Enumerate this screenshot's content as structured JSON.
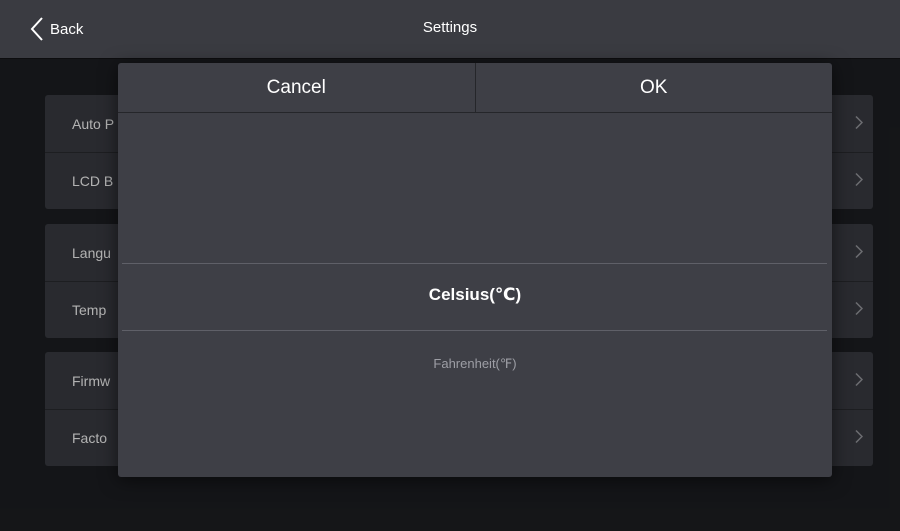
{
  "header": {
    "back_label": "Back",
    "title": "Settings",
    "back_icon": "chevron-left-icon"
  },
  "settings_groups": [
    {
      "items": [
        {
          "label": "Auto P"
        },
        {
          "label": "LCD B"
        }
      ]
    },
    {
      "items": [
        {
          "label": "Langu"
        },
        {
          "label": "Temp"
        }
      ]
    },
    {
      "items": [
        {
          "label": "Firmw"
        },
        {
          "label": "Facto"
        }
      ]
    }
  ],
  "dialog": {
    "cancel_label": "Cancel",
    "ok_label": "OK",
    "options": [
      {
        "label": "Celsius(℃)",
        "selected": true
      },
      {
        "label": "Fahrenheit(℉)",
        "selected": false
      }
    ]
  },
  "colors": {
    "background": "#1e1f23",
    "header_bar": "#3a3b41",
    "list_card": "#3b3d44",
    "dialog": "#3e3f46",
    "selected_text": "#ffffff",
    "unselected_text": "#9d9ea5"
  }
}
